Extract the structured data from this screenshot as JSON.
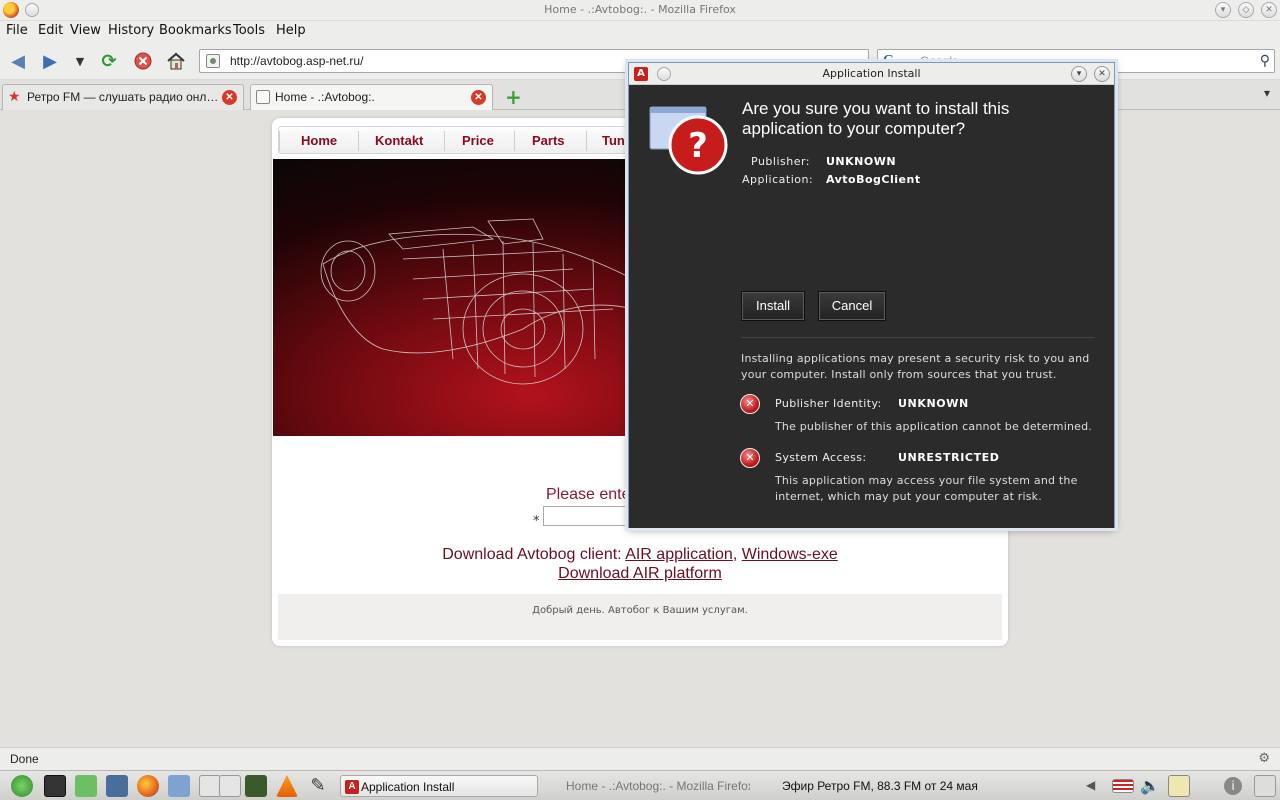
{
  "window": {
    "title": "Home - .:Avtobog:. - Mozilla Firefox"
  },
  "menu": [
    "File",
    "Edit",
    "View",
    "History",
    "Bookmarks",
    "Tools",
    "Help"
  ],
  "nav": {
    "url": "http://avtobog.asp-net.ru/",
    "search_placeholder": "Google"
  },
  "tabs": [
    {
      "label": "Ретро FM — слушать радио онл…",
      "active": false
    },
    {
      "label": "Home - .:Avtobog:.",
      "active": true
    }
  ],
  "site": {
    "nav": [
      "Home",
      "Kontakt",
      "Price",
      "Parts",
      "Tuni"
    ],
    "prompt": "Please ente",
    "required_mark": "*",
    "download_prefix": "Download Avtobog client:",
    "link_air": "AIR application",
    "comma": ",",
    "link_exe": "Windows-exe",
    "link_platform": "Download AIR platform",
    "footer": "Добрый день. Автобог к Вашим услугам."
  },
  "dialog": {
    "title": "Application Install",
    "heading": "Are you sure you want to install this application to your computer?",
    "publisher_label": "Publisher:",
    "publisher_value": "UNKNOWN",
    "application_label": "Application:",
    "application_value": "AvtoBogClient",
    "install": "Install",
    "cancel": "Cancel",
    "warning": "Installing applications may present a security risk to you and your computer. Install only from sources that you trust.",
    "risks": [
      {
        "label": "Publisher Identity:",
        "value": "UNKNOWN",
        "desc": "The publisher of this application cannot be determined."
      },
      {
        "label": "System Access:",
        "value": "UNRESTRICTED",
        "desc": "This application may access your file system and the internet, which may put your computer at risk."
      }
    ]
  },
  "status": "Done",
  "taskbar": {
    "tasks": [
      {
        "label": "Application Install",
        "active": true
      },
      {
        "label": "Home - .:Avtobog:. - Mozilla Firefox",
        "active": false
      },
      {
        "label": "Эфир Ретро FM, 88.3 FM от 24 мая",
        "active": false
      }
    ]
  },
  "colors": {
    "accent": "#8b0a20",
    "dialog_bg": "#2b2b2b",
    "danger": "#c31d1d"
  }
}
